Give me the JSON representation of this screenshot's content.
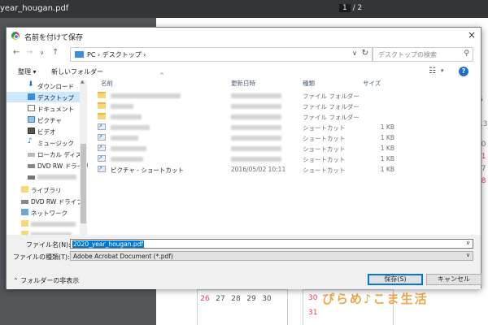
{
  "viewer": {
    "filename": "year_hougan.pdf",
    "page_current": "1",
    "page_sep": "/",
    "page_total": "2"
  },
  "calendar": {
    "left_row": [
      "26",
      "27",
      "28",
      "29",
      "30"
    ],
    "right_top": [
      "30"
    ],
    "right_bottom": [
      "31"
    ],
    "side_numbers": [
      "6",
      "13",
      "20",
      "27"
    ],
    "side_red": [
      "21",
      "28"
    ],
    "colors": {
      "weekday": "#555555",
      "holiday": "#e2445c"
    }
  },
  "logo": {
    "text": "ぴらめ♪こま生活",
    "color": "#f1a64a"
  },
  "dialog": {
    "title": "名前を付けて保存",
    "close_icon": "×",
    "nav": {
      "back_icon": "←",
      "forward_icon": "→",
      "recent_icon": "∨",
      "up_icon": "↑"
    },
    "address": {
      "crumbs": "PC  ›  デスクトップ  ›",
      "dropdown_icon": "∨",
      "refresh_icon": "↻"
    },
    "search": {
      "placeholder": "デスクトップの検索",
      "icon": "⚲"
    },
    "toolbar": {
      "organize": "整理 ▾",
      "new_folder": "新しいフォルダー",
      "view_icon": "☷",
      "view_dd": "▾",
      "help": "?"
    },
    "sidebar": {
      "items": [
        {
          "label": "ダウンロード"
        },
        {
          "label": "デスクトップ"
        },
        {
          "label": "ドキュメント"
        },
        {
          "label": "ピクチャ"
        },
        {
          "label": "ビデオ"
        },
        {
          "label": "ミュージック"
        },
        {
          "label": "ローカル ディスク ("
        },
        {
          "label": "DVD RW ドライブ"
        },
        {
          "label": ""
        },
        {
          "label": "ライブラリ"
        },
        {
          "label": "DVD RW ドライブ ("
        },
        {
          "label": "ネットワーク"
        },
        {
          "label": ""
        },
        {
          "label": ""
        }
      ]
    },
    "columns": {
      "name": "名前",
      "date": "更新日時",
      "type": "種類",
      "size": "サイズ",
      "sort_icon": "^"
    },
    "files": [
      {
        "icon": "folder",
        "name": "",
        "date": "",
        "type": "ファイル フォルダー",
        "size": ""
      },
      {
        "icon": "folder",
        "name": "",
        "date": "",
        "type": "ファイル フォルダー",
        "size": ""
      },
      {
        "icon": "folder",
        "name": "",
        "date": "",
        "type": "ファイル フォルダー",
        "size": ""
      },
      {
        "icon": "shortcut",
        "name": "",
        "date": "",
        "type": "ショートカット",
        "size": "1 KB"
      },
      {
        "icon": "shortcut",
        "name": "",
        "date": "",
        "type": "ショートカット",
        "size": "1 KB"
      },
      {
        "icon": "shortcut",
        "name": "",
        "date": "",
        "type": "ショートカット",
        "size": "1 KB"
      },
      {
        "icon": "shortcut",
        "name": "",
        "date": "",
        "type": "ショートカット",
        "size": "1 KB"
      },
      {
        "icon": "shortcut",
        "name": "ピクチャ - ショートカット",
        "date": "2016/05/02 10:11",
        "type": "ショートカット",
        "size": "1 KB"
      }
    ],
    "filename_label": "ファイル名(N):",
    "filename_value": "2020_year_hougan.pdf",
    "filetype_label": "ファイルの種類(T):",
    "filetype_value": "Adobe Acrobat Document (*.pdf)",
    "hide_folders": "⌃ フォルダーの非表示",
    "save": "保存(S)",
    "cancel": "キャンセル",
    "accent_color": "#0078d7"
  }
}
